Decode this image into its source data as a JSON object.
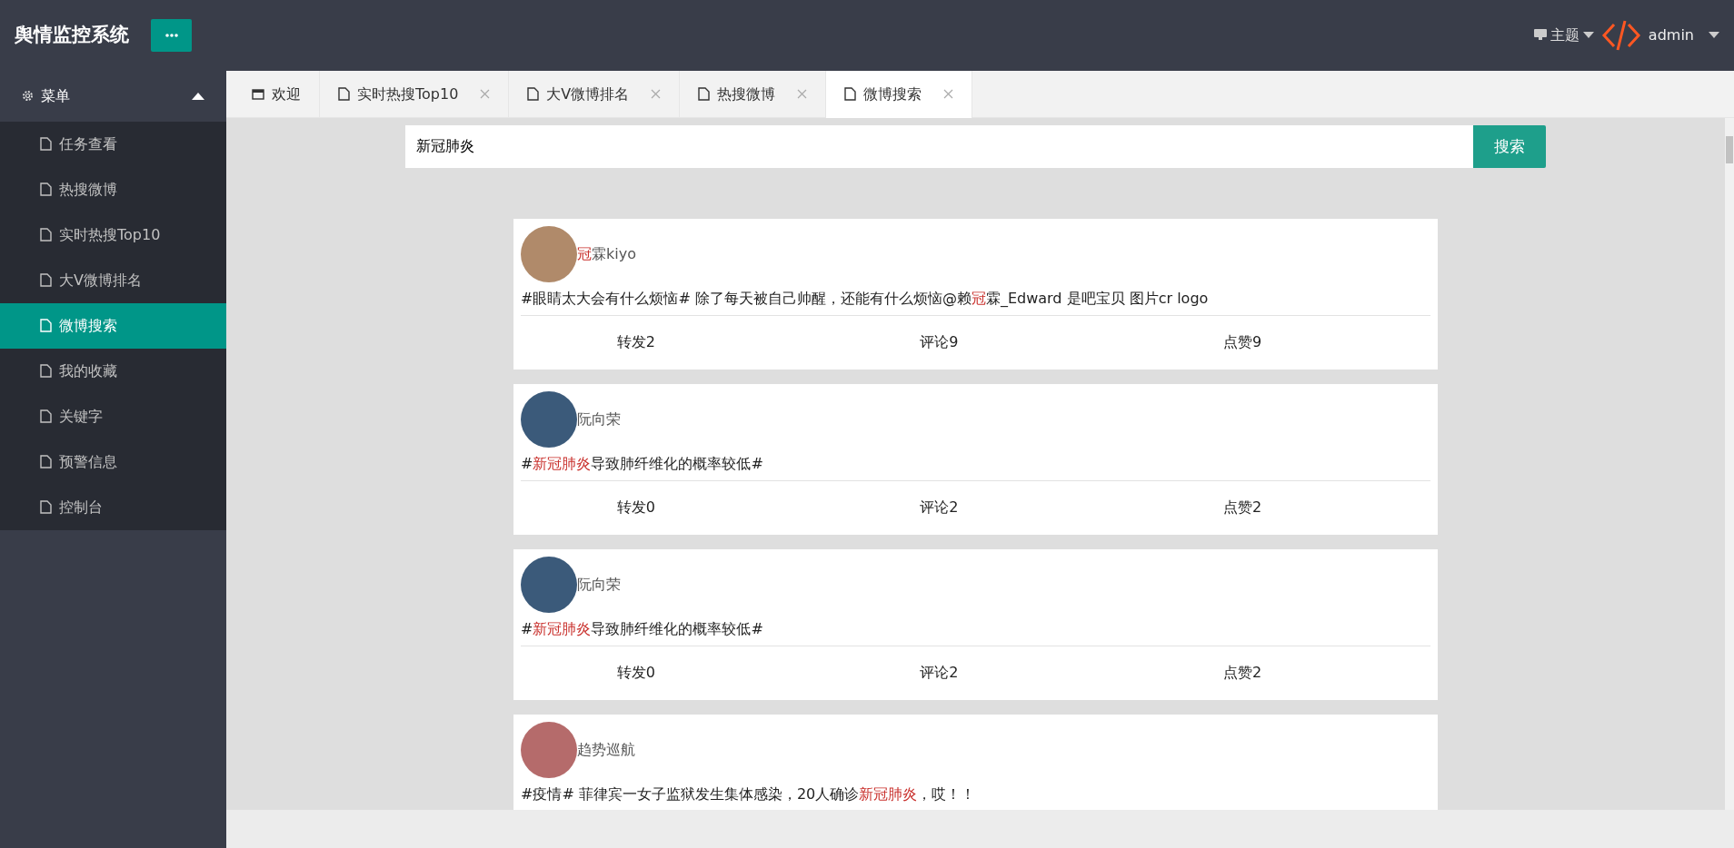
{
  "header": {
    "title": "舆情监控系统",
    "theme_label": "主题",
    "user": "admin"
  },
  "sidebar": {
    "heading": "菜单",
    "expanded": true,
    "items": [
      {
        "label": "任务查看",
        "selected": false
      },
      {
        "label": "热搜微博",
        "selected": false
      },
      {
        "label": "实时热搜Top10",
        "selected": false
      },
      {
        "label": "大V微博排名",
        "selected": false
      },
      {
        "label": "微博搜索",
        "selected": true
      },
      {
        "label": "我的收藏",
        "selected": false
      },
      {
        "label": "关键字",
        "selected": false
      },
      {
        "label": "预警信息",
        "selected": false
      },
      {
        "label": "控制台",
        "selected": false
      }
    ]
  },
  "tabs": [
    {
      "label": "欢迎",
      "kind": "home",
      "selected": false
    },
    {
      "label": "实时热搜Top10",
      "kind": "page",
      "selected": false
    },
    {
      "label": "大V微博排名",
      "kind": "page",
      "selected": false
    },
    {
      "label": "热搜微博",
      "kind": "page",
      "selected": false
    },
    {
      "label": "微博搜索",
      "kind": "page",
      "selected": true
    }
  ],
  "search": {
    "value": "新冠肺炎",
    "button": "搜索"
  },
  "posts": [
    {
      "author": [
        {
          "text": "冠",
          "highlight": true
        },
        {
          "text": "霖kiyo",
          "highlight": false
        }
      ],
      "text": [
        {
          "text": "#眼睛太大会有什么烦恼# 除了每天被自己帅醒，还能有什么烦恼@赖",
          "highlight": false
        },
        {
          "text": "冠",
          "highlight": true
        },
        {
          "text": "霖_Edward 是吧宝贝 图片cr logo",
          "highlight": false
        }
      ],
      "actions": [
        "转发2",
        "评论9",
        "点赞9"
      ]
    },
    {
      "author": [
        {
          "text": "阮向荣",
          "highlight": false
        }
      ],
      "text": [
        {
          "text": "#",
          "highlight": false
        },
        {
          "text": "新冠肺炎",
          "highlight": true
        },
        {
          "text": "导致肺纤维化的概率较低#",
          "highlight": false
        }
      ],
      "actions": [
        "转发0",
        "评论2",
        "点赞2"
      ]
    },
    {
      "author": [
        {
          "text": "阮向荣",
          "highlight": false
        }
      ],
      "text": [
        {
          "text": "#",
          "highlight": false
        },
        {
          "text": "新冠肺炎",
          "highlight": true
        },
        {
          "text": "导致肺纤维化的概率较低#",
          "highlight": false
        }
      ],
      "actions": [
        "转发0",
        "评论2",
        "点赞2"
      ]
    },
    {
      "author": [
        {
          "text": "趋势巡航",
          "highlight": false
        }
      ],
      "text": [
        {
          "text": "#疫情# 菲律宾一女子监狱发生集体感染，20人确诊",
          "highlight": false
        },
        {
          "text": "新冠肺炎",
          "highlight": true
        },
        {
          "text": "，哎！！",
          "highlight": false
        }
      ]
    }
  ]
}
